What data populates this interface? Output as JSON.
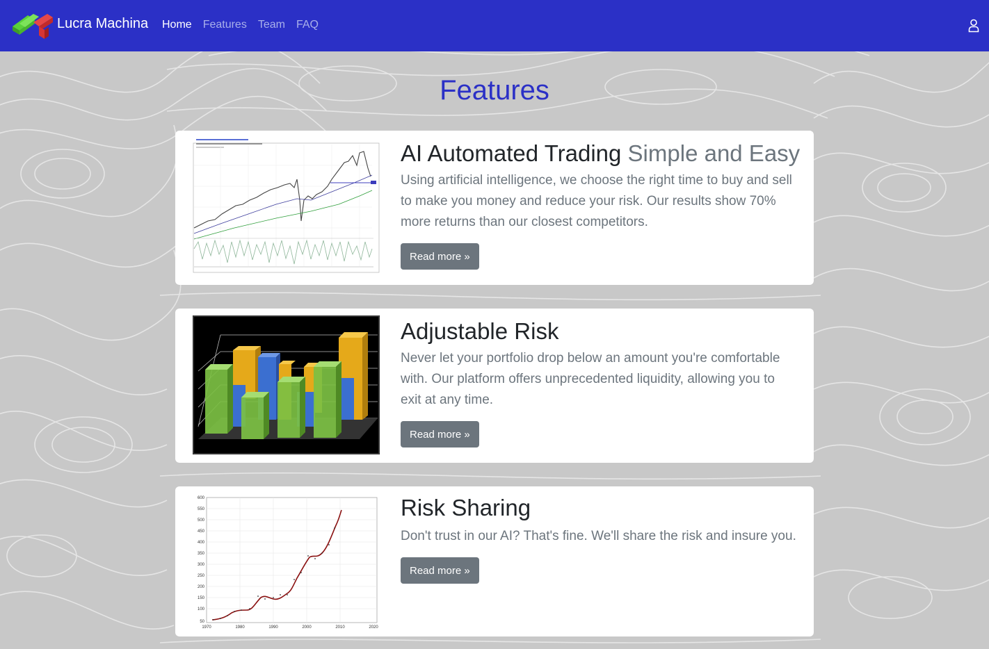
{
  "brand": {
    "name": "Lucra Machina"
  },
  "nav": {
    "links": [
      "Home",
      "Features",
      "Team",
      "FAQ"
    ],
    "active": "Home"
  },
  "page": {
    "title": "Features"
  },
  "features": [
    {
      "title": "AI Automated Trading",
      "title_muted": "Simple and Easy",
      "text": "Using artificial intelligence, we choose the right time to buy and sell to make you money and reduce your risk. Our results show 70% more returns than our closest competitors.",
      "button": "Read more »"
    },
    {
      "title": "Adjustable Risk",
      "title_muted": "",
      "text": "Never let your portfolio drop below an amount you're comfortable with. Our platform offers unprecedented liquidity, allowing you to exit at any time.",
      "button": "Read more »"
    },
    {
      "title": "Risk Sharing",
      "title_muted": "",
      "text": "Don't trust in our AI? That's fine. We'll share the risk and insure you.",
      "button": "Read more »"
    }
  ],
  "colors": {
    "navbar": "#2b30c6",
    "accent": "#2b30c6",
    "button": "#6c757d"
  },
  "images": {
    "feature_1": "stock-price-chart-thumbnail",
    "feature_2": "3d-bar-chart-thumbnail",
    "feature_3": "growth-curve-chart-thumbnail"
  },
  "risk_chart": {
    "y_ticks": [
      "600",
      "550",
      "500",
      "450",
      "400",
      "350",
      "300",
      "250",
      "200",
      "150",
      "100",
      "50"
    ],
    "x_ticks": [
      "1970",
      "1980",
      "1990",
      "2000",
      "2010",
      "2020"
    ]
  }
}
